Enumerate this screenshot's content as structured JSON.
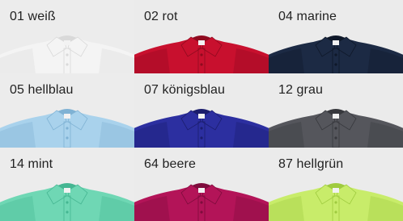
{
  "swatches": [
    {
      "label": "01 weiß",
      "color": "#f4f4f4",
      "shade": "#d9d9d9",
      "bg": "#ececec"
    },
    {
      "label": "02 rot",
      "color": "#c8102e",
      "shade": "#8f0a1f",
      "bg": "#ebebeb"
    },
    {
      "label": "04 marine",
      "color": "#1c2a44",
      "shade": "#0f1829",
      "bg": "#ebebeb"
    },
    {
      "label": "05 hellblau",
      "color": "#a9d2ec",
      "shade": "#7fb2d4",
      "bg": "#ececec"
    },
    {
      "label": "07 königsblau",
      "color": "#2c2fa0",
      "shade": "#1b1d6d",
      "bg": "#ebebeb"
    },
    {
      "label": "12 grau",
      "color": "#55565c",
      "shade": "#37383d",
      "bg": "#ebebeb"
    },
    {
      "label": "14 mint",
      "color": "#6fd7b4",
      "shade": "#45b692",
      "bg": "#ececec"
    },
    {
      "label": "64 beere",
      "color": "#b31458",
      "shade": "#7e0c3c",
      "bg": "#ebebeb"
    },
    {
      "label": "87 hellgrün",
      "color": "#c8ec6a",
      "shade": "#9fcb3f",
      "bg": "#ebebeb"
    }
  ]
}
